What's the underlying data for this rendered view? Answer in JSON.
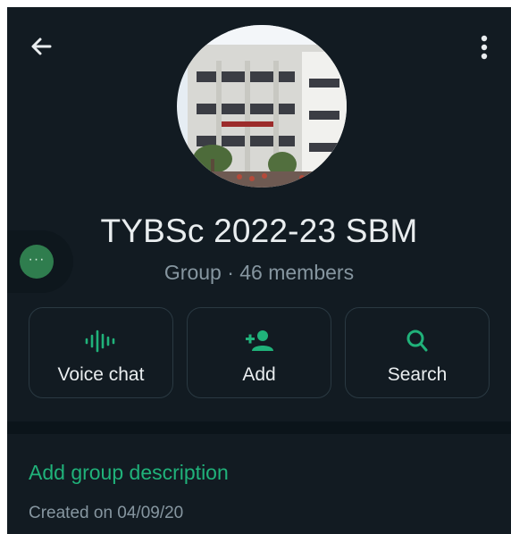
{
  "header": {
    "back_icon": "arrow-left-icon",
    "menu_icon": "more-vert-icon"
  },
  "group": {
    "name": "TYBSc 2022-23 SBM",
    "subtitle": "Group · 46 members"
  },
  "side_bubble": {
    "label": "···"
  },
  "actions": [
    {
      "label": "Voice chat",
      "icon": "voice-wave-icon"
    },
    {
      "label": "Add",
      "icon": "add-person-icon"
    },
    {
      "label": "Search",
      "icon": "search-icon"
    }
  ],
  "details": {
    "description_link": "Add group description",
    "created": "Created on 04/09/20"
  },
  "colors": {
    "background": "#121b22",
    "accent_green": "#20b27a",
    "text_primary": "#e9edef",
    "text_secondary": "#8696a0"
  }
}
